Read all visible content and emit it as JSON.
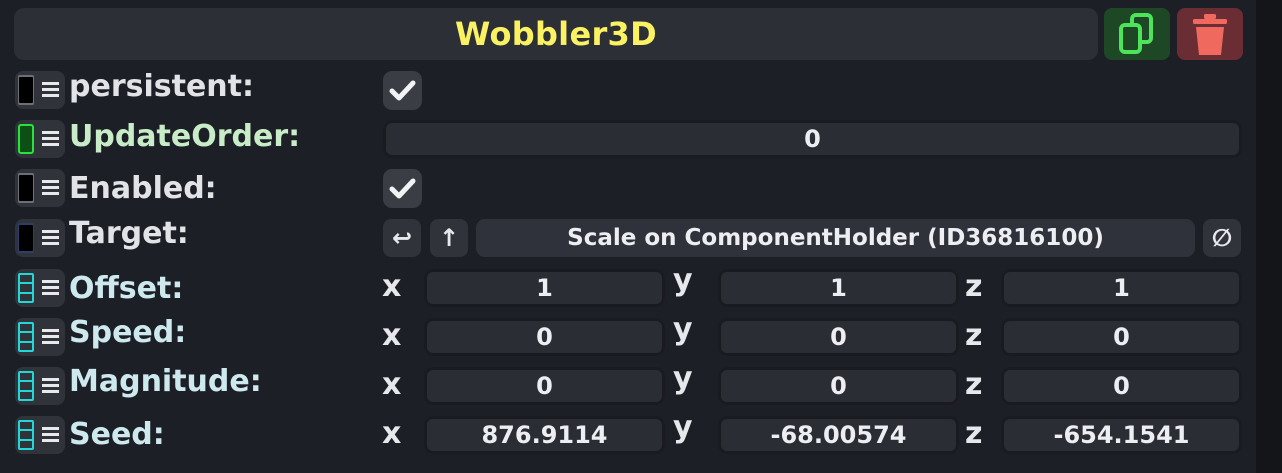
{
  "component": {
    "title": "Wobbler3D"
  },
  "icons": {
    "duplicate": "copy-icon",
    "delete": "trash-icon",
    "check": "checkmark-icon",
    "menu": "hamburger-icon"
  },
  "colors": {
    "title": "#fbf263",
    "duplicate_bg": "#1e4725",
    "duplicate_icon": "#4de35a",
    "delete_bg": "#6a2d33",
    "delete_icon": "#f0695f"
  },
  "fields": {
    "persistent": {
      "label": "persistent:",
      "checked": true
    },
    "update_order": {
      "label": "UpdateOrder:",
      "value": "0"
    },
    "enabled": {
      "label": "Enabled:",
      "checked": true
    },
    "target": {
      "label": "Target:",
      "value": "Scale on ComponentHolder (ID36816100)",
      "jump_glyph": "↩",
      "up_glyph": "↑",
      "clear_glyph": "∅"
    },
    "offset": {
      "label": "Offset:",
      "x": "1",
      "y": "1",
      "z": "1"
    },
    "speed": {
      "label": "Speed:",
      "x": "0",
      "y": "0",
      "z": "0"
    },
    "magnitude": {
      "label": "Magnitude:",
      "x": "0",
      "y": "0",
      "z": "0"
    },
    "seed": {
      "label": "Seed:",
      "x": "876.9114",
      "y": "-68.00574",
      "z": "-654.1541"
    }
  },
  "axis_labels": {
    "x": "x",
    "y": "y",
    "z": "z"
  }
}
